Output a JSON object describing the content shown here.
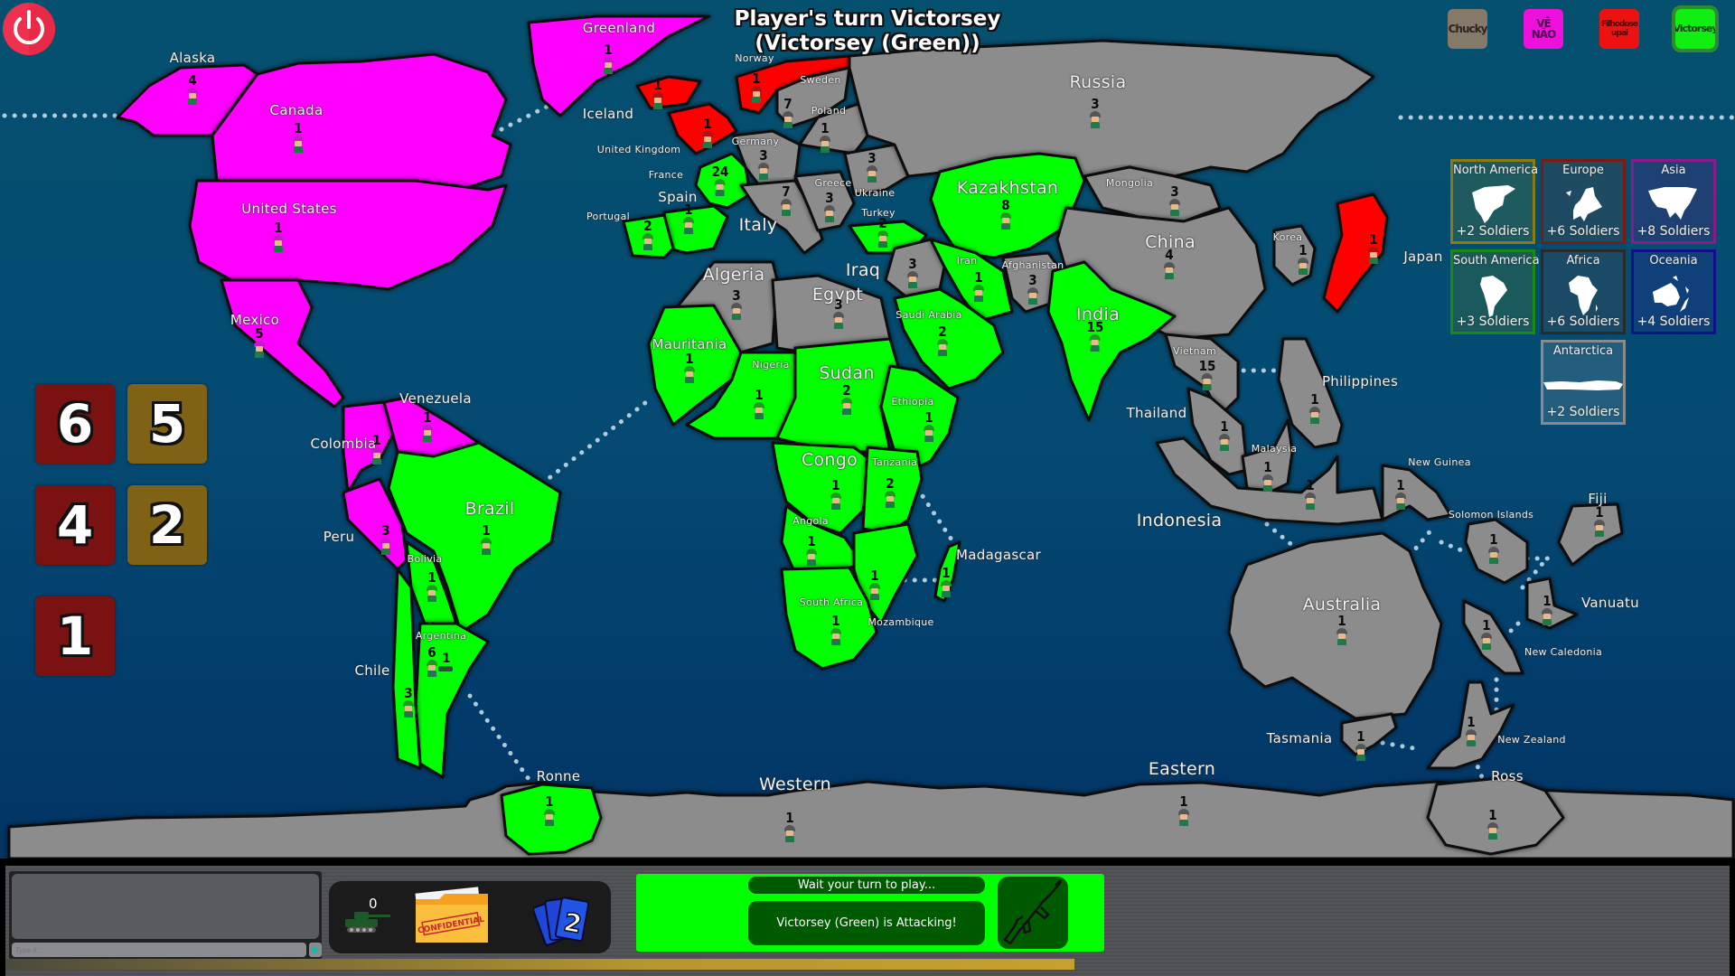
{
  "header": {
    "title_line1": "Player's turn Victorsey",
    "title_line2": "(Victorsey (Green))"
  },
  "power_button": {
    "icon": "power-icon"
  },
  "players": [
    {
      "name": "Chucky",
      "color": "#857a6a",
      "text_color": "#2b2420",
      "active": false
    },
    {
      "name": "VÊ NÃO",
      "color": "#ee11dd",
      "text_color": "#4a0a4a",
      "active": false
    },
    {
      "name": "Filhodoseupai",
      "color": "#ee1111",
      "text_color": "#5a0000",
      "active": false
    },
    {
      "name": "Victorsey",
      "color": "#11ee11",
      "text_color": "#0a3a0a",
      "active": true
    }
  ],
  "continents": [
    {
      "name": "North America",
      "bonus": "+2 Soldiers",
      "border": "#8a7a10",
      "bg": "#1e5a5e"
    },
    {
      "name": "Europe",
      "bonus": "+6 Soldiers",
      "border": "#7a1a10",
      "bg": "#1e4a62"
    },
    {
      "name": "Asia",
      "bonus": "+8 Soldiers",
      "border": "#8a1a8a",
      "bg": "#1e4072"
    },
    {
      "name": "South America",
      "bonus": "+3 Soldiers",
      "border": "#1a8a10",
      "bg": "#1a5a5c"
    },
    {
      "name": "Africa",
      "bonus": "+6 Soldiers",
      "border": "#2a2a2a",
      "bg": "#1a4a66"
    },
    {
      "name": "Oceania",
      "bonus": "+4 Soldiers",
      "border": "#10108a",
      "bg": "#10407a"
    },
    {
      "name": "Antarctica",
      "bonus": "+2 Soldiers",
      "border": "#8a8a8a",
      "bg": "#235e7e"
    }
  ],
  "dice": {
    "attack": [
      6,
      4,
      1
    ],
    "defense": [
      5,
      2
    ]
  },
  "owner_colors": {
    "magenta": "#ff00ff",
    "red": "#ff0000",
    "green": "#00ff00",
    "gray": "#8c8c8c"
  },
  "territories": [
    {
      "name": "Alaska",
      "count": "4",
      "owner": "magenta"
    },
    {
      "name": "Canada",
      "count": "1",
      "owner": "magenta"
    },
    {
      "name": "Greenland",
      "count": "1",
      "owner": "magenta"
    },
    {
      "name": "United States",
      "count": "1",
      "owner": "magenta"
    },
    {
      "name": "Mexico",
      "count": "5",
      "owner": "magenta"
    },
    {
      "name": "Venezuela",
      "count": "1",
      "owner": "magenta"
    },
    {
      "name": "Colombia",
      "count": "1",
      "owner": "magenta"
    },
    {
      "name": "Peru",
      "count": "3",
      "owner": "magenta"
    },
    {
      "name": "Brazil",
      "count": "1",
      "owner": "green"
    },
    {
      "name": "Bolivia",
      "count": "1",
      "owner": "green"
    },
    {
      "name": "Argentina",
      "count": "6",
      "owner": "green",
      "extra": "1"
    },
    {
      "name": "Chile",
      "count": "3",
      "owner": "green"
    },
    {
      "name": "Iceland",
      "count": "1",
      "owner": "red"
    },
    {
      "name": "United Kingdom",
      "count": "1",
      "owner": "red"
    },
    {
      "name": "Norway",
      "count": "1",
      "owner": "red"
    },
    {
      "name": "Sweden",
      "count": "7",
      "owner": "gray"
    },
    {
      "name": "Poland",
      "count": "1",
      "owner": "gray"
    },
    {
      "name": "Germany",
      "count": "3",
      "owner": "gray"
    },
    {
      "name": "France",
      "count": "24",
      "owner": "green"
    },
    {
      "name": "Spain",
      "count": "1",
      "owner": "green"
    },
    {
      "name": "Portugal",
      "count": "2",
      "owner": "green"
    },
    {
      "name": "Italy",
      "count": "7",
      "owner": "gray"
    },
    {
      "name": "Greece",
      "count": "3",
      "owner": "gray"
    },
    {
      "name": "Ukraine",
      "count": "3",
      "owner": "gray"
    },
    {
      "name": "Turkey",
      "count": "2",
      "owner": "green"
    },
    {
      "name": "Russia",
      "count": "3",
      "owner": "gray"
    },
    {
      "name": "Kazakhstan",
      "count": "8",
      "owner": "green"
    },
    {
      "name": "Mongolia",
      "count": "3",
      "owner": "gray"
    },
    {
      "name": "China",
      "count": "4",
      "owner": "gray"
    },
    {
      "name": "Korea",
      "count": "1",
      "owner": "gray"
    },
    {
      "name": "Japan",
      "count": "1",
      "owner": "red"
    },
    {
      "name": "Iraq",
      "count": "3",
      "owner": "gray"
    },
    {
      "name": "Iran",
      "count": "1",
      "owner": "green"
    },
    {
      "name": "Afghanistan",
      "count": "3",
      "owner": "gray"
    },
    {
      "name": "Saudi Arabia",
      "count": "2",
      "owner": "green"
    },
    {
      "name": "India",
      "count": "15",
      "owner": "green"
    },
    {
      "name": "Vietnam",
      "count": "15",
      "owner": "gray"
    },
    {
      "name": "Thailand",
      "count": "1",
      "owner": "gray"
    },
    {
      "name": "Malaysia",
      "count": "1",
      "owner": "gray"
    },
    {
      "name": "Philippines",
      "count": "1",
      "owner": "gray"
    },
    {
      "name": "Indonesia",
      "count": "1",
      "owner": "gray"
    },
    {
      "name": "New Guinea",
      "count": "1",
      "owner": "gray"
    },
    {
      "name": "Algeria",
      "count": "3",
      "owner": "gray"
    },
    {
      "name": "Egypt",
      "count": "3",
      "owner": "gray"
    },
    {
      "name": "Mauritania",
      "count": "1",
      "owner": "green"
    },
    {
      "name": "Nigeria",
      "count": "1",
      "owner": "green"
    },
    {
      "name": "Sudan",
      "count": "2",
      "owner": "green"
    },
    {
      "name": "Ethiopia",
      "count": "1",
      "owner": "green"
    },
    {
      "name": "Congo",
      "count": "1",
      "owner": "green"
    },
    {
      "name": "Tanzania",
      "count": "2",
      "owner": "green"
    },
    {
      "name": "Angola",
      "count": "1",
      "owner": "green"
    },
    {
      "name": "Mozambique",
      "count": "1",
      "owner": "green"
    },
    {
      "name": "South Africa",
      "count": "1",
      "owner": "green"
    },
    {
      "name": "Madagascar",
      "count": "1",
      "owner": "green"
    },
    {
      "name": "Australia",
      "count": "1",
      "owner": "gray"
    },
    {
      "name": "Solomon Islands",
      "count": "1",
      "owner": "gray"
    },
    {
      "name": "Fiji",
      "count": "1",
      "owner": "gray"
    },
    {
      "name": "Vanuatu",
      "count": "1",
      "owner": "gray"
    },
    {
      "name": "New Caledonia",
      "count": "1",
      "owner": "gray"
    },
    {
      "name": "Tasmania",
      "count": "1",
      "owner": "gray"
    },
    {
      "name": "New Zealand",
      "count": "1",
      "owner": "gray"
    },
    {
      "name": "Ronne",
      "count": "1",
      "owner": "green"
    },
    {
      "name": "Western",
      "count": "1",
      "owner": "gray"
    },
    {
      "name": "Eastern",
      "count": "1",
      "owner": "gray"
    },
    {
      "name": "Ross",
      "count": "1",
      "owner": "gray"
    }
  ],
  "bottom_bar": {
    "chat_placeholder": "Type it...",
    "send_icon": "send-arrow-icon",
    "tanks_count": "0",
    "folder_label": "CONFIDENTIAL",
    "cards_count": "2",
    "wait_message": "Wait your turn to play...",
    "attack_message": "Victorsey (Green) is Attacking!",
    "attack_icon": "rifle-icon",
    "panel_color": "#00ff00",
    "turn_timer_fraction": 0.62
  }
}
